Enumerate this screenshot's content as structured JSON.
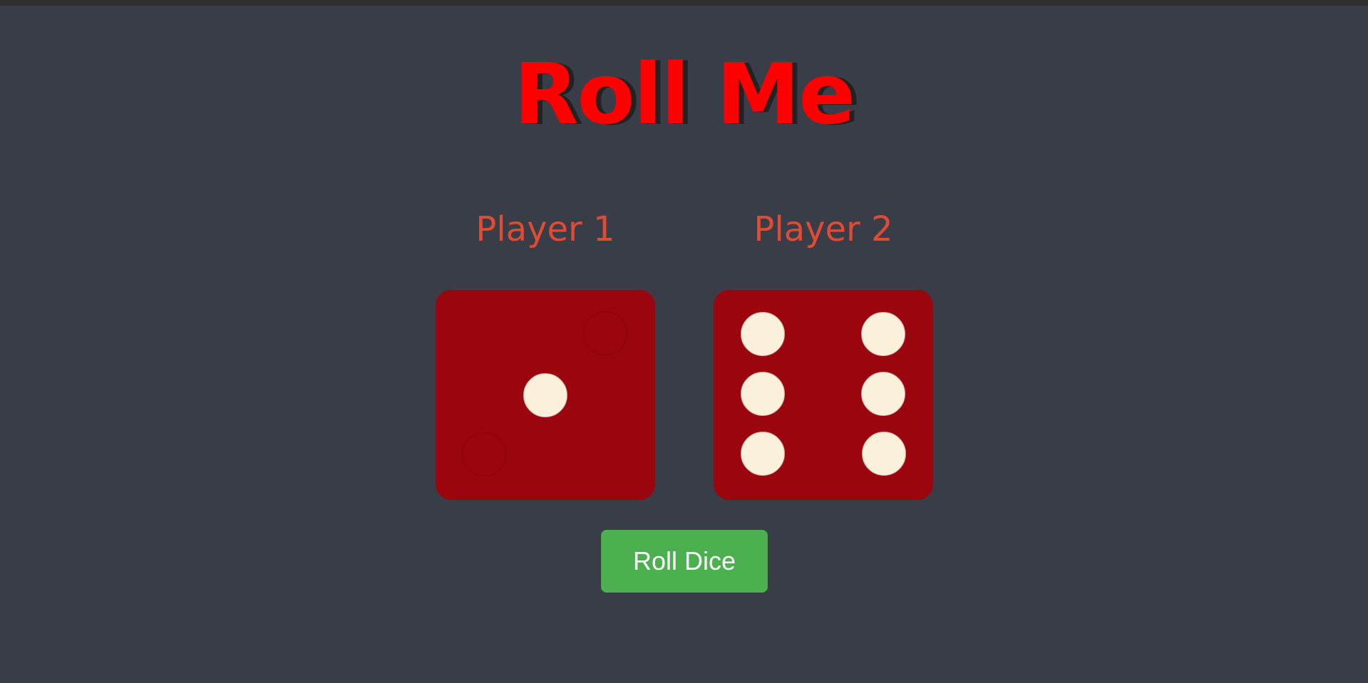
{
  "title": "Roll Me",
  "players": [
    {
      "label": "Player 1",
      "die_value": 1
    },
    {
      "label": "Player 2",
      "die_value": 6
    }
  ],
  "roll_button_label": "Roll Dice",
  "colors": {
    "background": "#393d47",
    "title": "#ff0000",
    "player_label": "#e04b33",
    "die": "#9b050e",
    "pip": "#fbf0d9",
    "button": "#4caf50"
  }
}
